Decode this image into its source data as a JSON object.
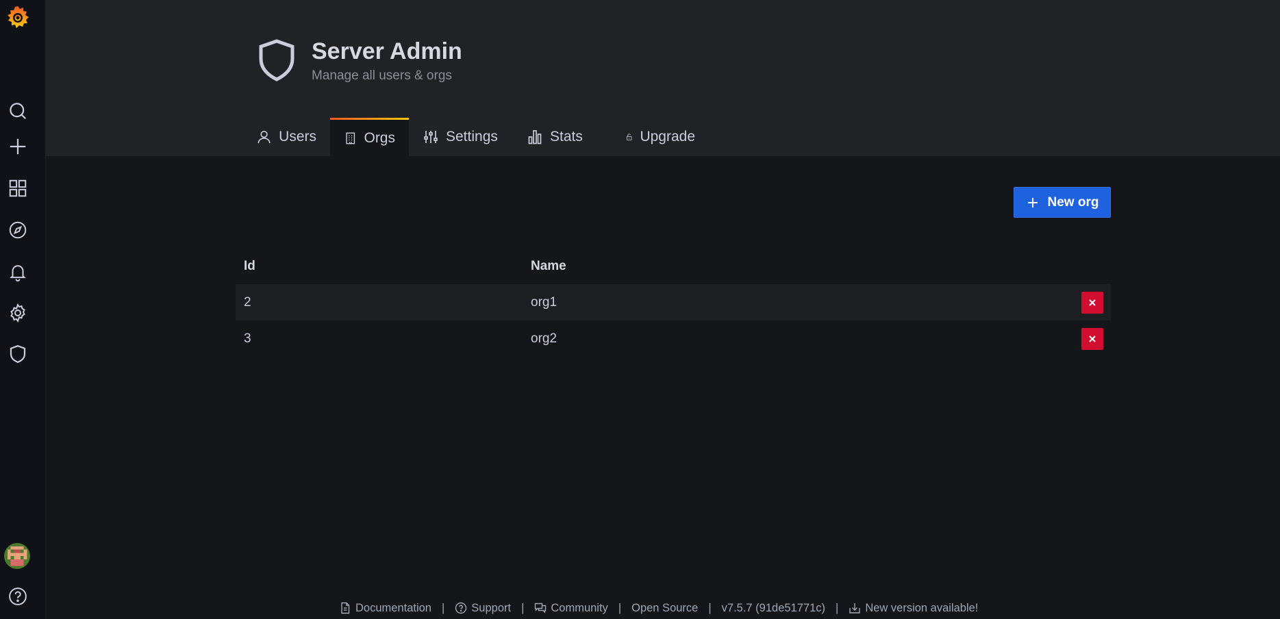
{
  "sidebar": {
    "items": [
      {
        "icon": "search-icon",
        "label": "Search"
      },
      {
        "icon": "plus-icon",
        "label": "Create"
      },
      {
        "icon": "dashboards-icon",
        "label": "Dashboards"
      },
      {
        "icon": "compass-icon",
        "label": "Explore"
      },
      {
        "icon": "bell-icon",
        "label": "Alerting"
      },
      {
        "icon": "gear-icon",
        "label": "Configuration"
      },
      {
        "icon": "shield-icon",
        "label": "Server Admin"
      }
    ],
    "help_icon": "question-circle-icon"
  },
  "header": {
    "title": "Server Admin",
    "subtitle": "Manage all users & orgs",
    "tabs": [
      {
        "label": "Users",
        "icon": "user-icon",
        "active": false
      },
      {
        "label": "Orgs",
        "icon": "building-icon",
        "active": true
      },
      {
        "label": "Settings",
        "icon": "sliders-icon",
        "active": false
      },
      {
        "label": "Stats",
        "icon": "bar-chart-icon",
        "active": false
      },
      {
        "label": "Upgrade",
        "icon": "unlock-icon",
        "active": false
      }
    ]
  },
  "toolbar": {
    "new_org_label": "New org"
  },
  "table": {
    "columns": [
      "Id",
      "Name"
    ],
    "rows": [
      {
        "id": "2",
        "name": "org1"
      },
      {
        "id": "3",
        "name": "org2"
      }
    ]
  },
  "footer": {
    "documentation": "Documentation",
    "support": "Support",
    "community": "Community",
    "open_source": "Open Source",
    "version": "v7.5.7 (91de51771c)",
    "new_version": "New version available!",
    "separator": "|"
  },
  "colors": {
    "primary": "#1f62e0",
    "danger": "#d10e2f",
    "tab_accent": "#f08c2d"
  }
}
